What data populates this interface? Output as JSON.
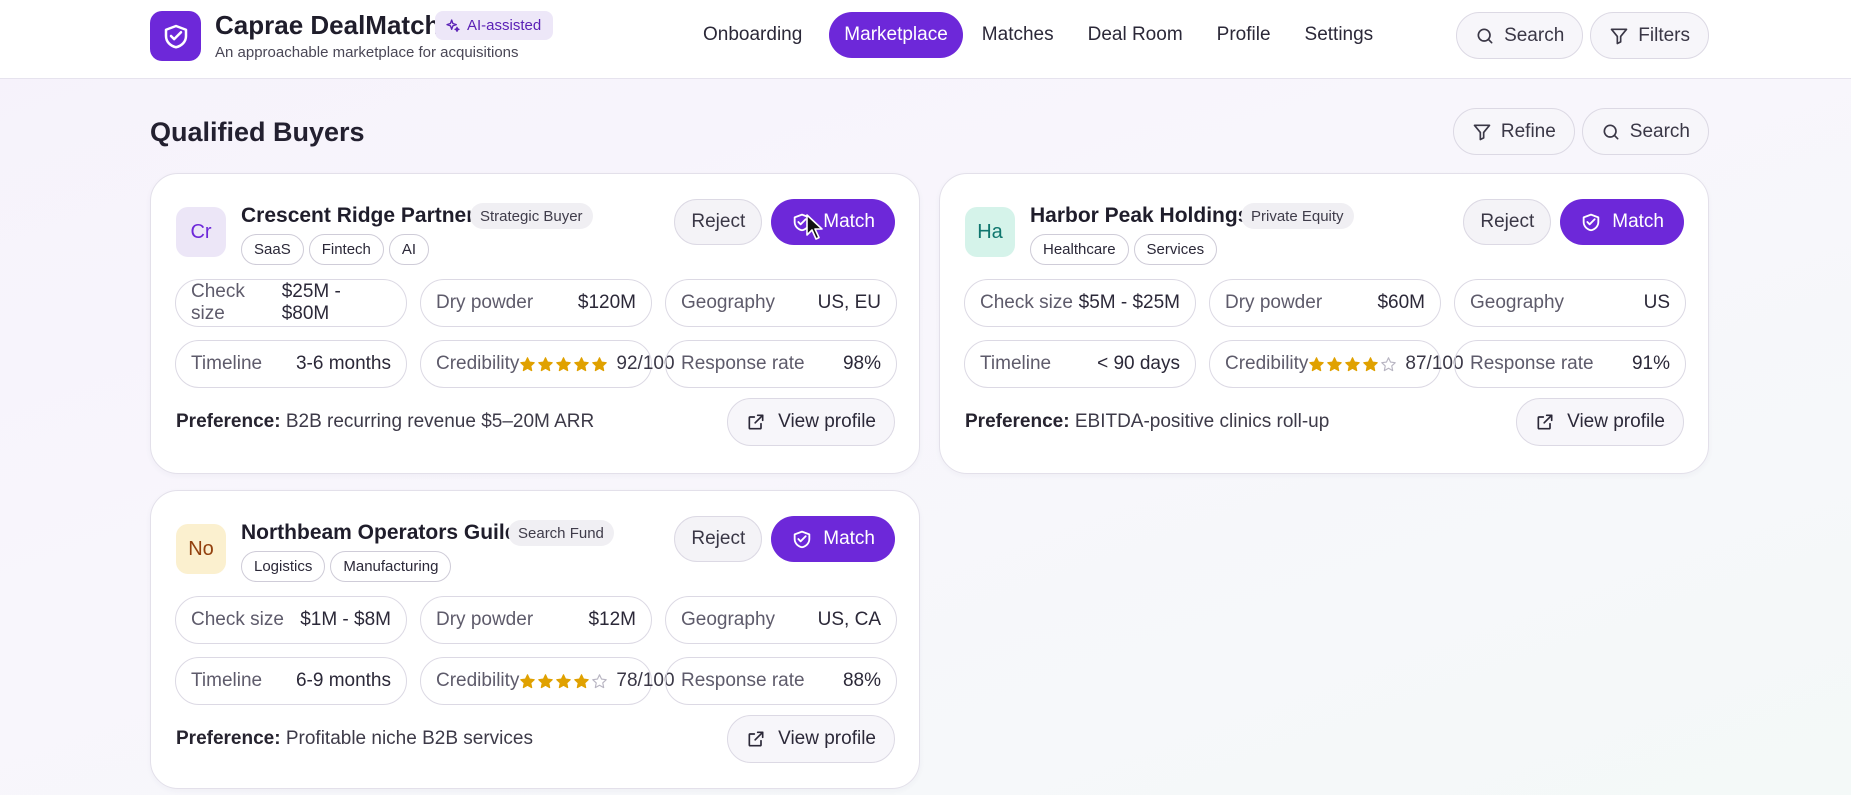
{
  "app": {
    "title": "Caprae DealMatch",
    "ai_badge": "AI-assisted",
    "subtitle": "An approachable marketplace for acquisitions"
  },
  "nav": {
    "items": [
      {
        "label": "Onboarding",
        "active": false
      },
      {
        "label": "Marketplace",
        "active": true
      },
      {
        "label": "Matches",
        "active": false
      },
      {
        "label": "Deal Room",
        "active": false
      },
      {
        "label": "Profile",
        "active": false
      },
      {
        "label": "Settings",
        "active": false
      }
    ],
    "search_label": "Search",
    "filters_label": "Filters"
  },
  "page": {
    "title": "Qualified Buyers",
    "refine_label": "Refine",
    "search_label": "Search"
  },
  "buyers": [
    {
      "initials": "Cr",
      "avatar_bg": "#ece6f7",
      "avatar_fg": "#6d28d9",
      "name": "Crescent Ridge Partners",
      "type": "Strategic Buyer",
      "tags": [
        "SaaS",
        "Fintech",
        "AI"
      ],
      "reject_label": "Reject",
      "match_label": "Match",
      "check_size_label": "Check size",
      "check_size": "$25M - $80M",
      "dry_powder_label": "Dry powder",
      "dry_powder": "$120M",
      "geography_label": "Geography",
      "geography": "US, EU",
      "timeline_label": "Timeline",
      "timeline": "3-6 months",
      "credibility_label": "Credibility",
      "credibility": "92/100",
      "stars": 5,
      "response_rate_label": "Response rate",
      "response_rate": "98%",
      "preference_label": "Preference:",
      "preference": "B2B recurring revenue $5–20M ARR",
      "view_label": "View profile"
    },
    {
      "initials": "Ha",
      "avatar_bg": "#d5f3ea",
      "avatar_fg": "#0f766e",
      "name": "Harbor Peak Holdings",
      "type": "Private Equity",
      "tags": [
        "Healthcare",
        "Services"
      ],
      "reject_label": "Reject",
      "match_label": "Match",
      "check_size_label": "Check size",
      "check_size": "$5M - $25M",
      "dry_powder_label": "Dry powder",
      "dry_powder": "$60M",
      "geography_label": "Geography",
      "geography": "US",
      "timeline_label": "Timeline",
      "timeline": "< 90 days",
      "credibility_label": "Credibility",
      "credibility": "87/100",
      "stars": 4,
      "response_rate_label": "Response rate",
      "response_rate": "91%",
      "preference_label": "Preference:",
      "preference": "EBITDA-positive clinics roll-up",
      "view_label": "View profile"
    },
    {
      "initials": "No",
      "avatar_bg": "#fbf0cf",
      "avatar_fg": "#92400e",
      "name": "Northbeam Operators Guild",
      "type": "Search Fund",
      "tags": [
        "Logistics",
        "Manufacturing"
      ],
      "reject_label": "Reject",
      "match_label": "Match",
      "check_size_label": "Check size",
      "check_size": "$1M - $8M",
      "dry_powder_label": "Dry powder",
      "dry_powder": "$12M",
      "geography_label": "Geography",
      "geography": "US, CA",
      "timeline_label": "Timeline",
      "timeline": "6-9 months",
      "credibility_label": "Credibility",
      "credibility": "78/100",
      "stars": 4,
      "response_rate_label": "Response rate",
      "response_rate": "88%",
      "preference_label": "Preference:",
      "preference": "Profitable niche B2B services",
      "view_label": "View profile"
    }
  ],
  "colors": {
    "accent": "#6d28d9",
    "star": "#e0a100",
    "star_empty": "#b8b5c2"
  }
}
